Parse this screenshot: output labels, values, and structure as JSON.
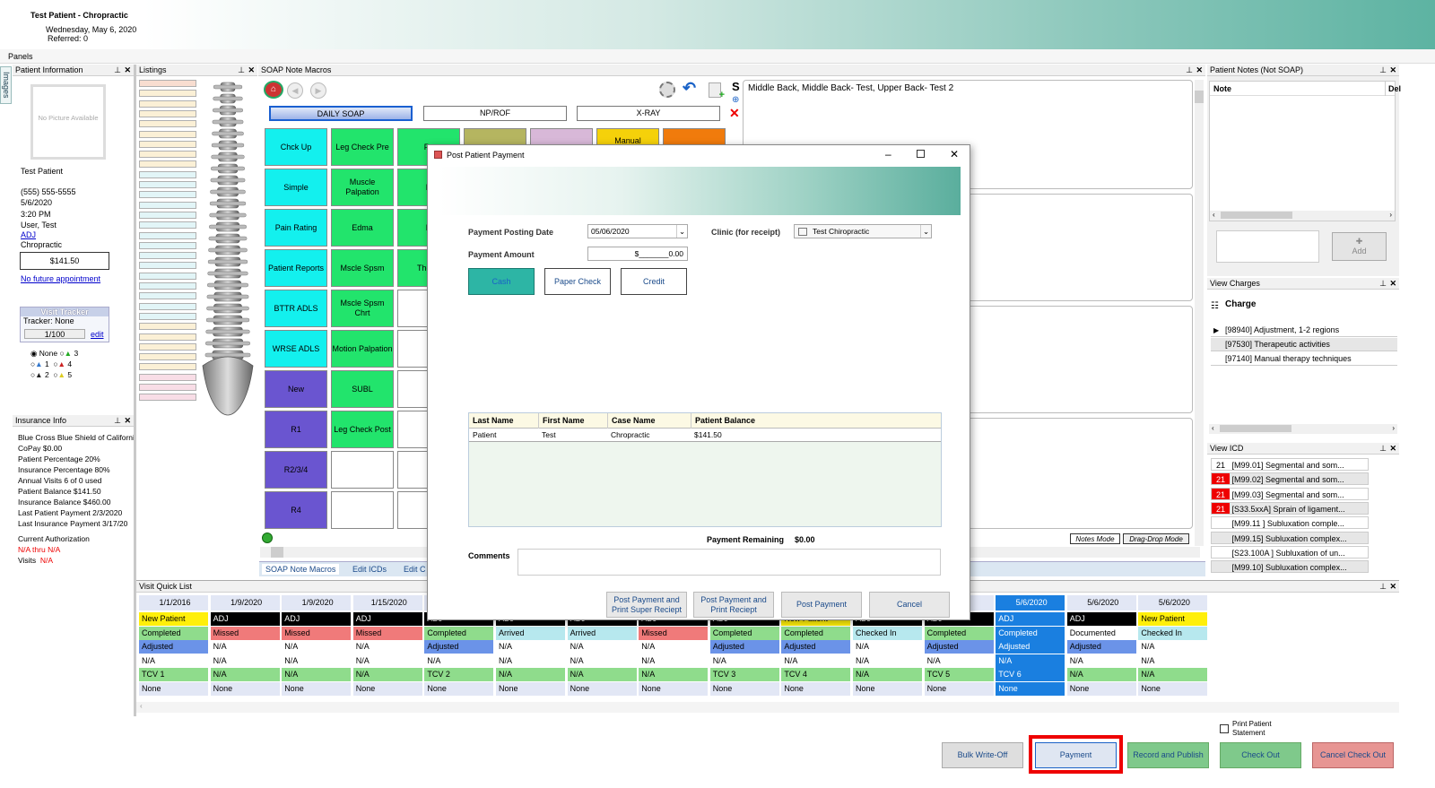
{
  "header": {
    "title": "Test Patient - Chropractic",
    "date": "Wednesday, May 6, 2020",
    "referred": "Referred: 0"
  },
  "panels_label": "Panels",
  "images_tab": "Images",
  "patient_info": {
    "title": "Patient Information",
    "no_picture": "No Picture Available",
    "name": "Test Patient",
    "phone": "(555) 555-5555",
    "date": "5/6/2020",
    "time": "3:20 PM",
    "user": "User, Test",
    "adj": "ADJ",
    "clinic": "Chropractic",
    "balance": "$141.50",
    "future": "No future appointment",
    "tracker_title": "Visit Tracker",
    "tracker": "Tracker: None",
    "tracker_val": "1/100",
    "edit": "edit",
    "radios": [
      "None",
      "1",
      "2",
      "3",
      "4",
      "5"
    ]
  },
  "insurance": {
    "title": "Insurance Info",
    "lines": [
      "Blue Cross Blue Shield of California",
      "CoPay    $0.00",
      "Patient Percentage    20%",
      "Insurance Percentage    80%",
      "Annual Visits    6 of 0 used",
      "Patient Balance    $141.50",
      "Insurance Balance    $460.00",
      "Last Patient Payment        2/3/2020",
      "Last Insurance Payment    3/17/20"
    ],
    "auth": "Current Authorization",
    "na": "N/A thru N/A",
    "visits": "Visits",
    "visits_val": "N/A"
  },
  "listings_title": "Listings",
  "soap": {
    "title": "SOAP Note Macros",
    "tabs": [
      "DAILY SOAP",
      "NP/ROF",
      "X-RAY"
    ],
    "col1": [
      "Chck Up",
      "Simple",
      "Pain Rating",
      "Patient Reports",
      "BTTR ADLS",
      "WRSE ADLS",
      "New",
      "R1",
      "R2/3/4",
      "R4"
    ],
    "col2": [
      "Leg Check Pre",
      "Muscle Palpation",
      "Edma",
      "Mscle Spsm",
      "Mscle Spsm Chrt",
      "Motion Palpation",
      "SUBL",
      "Leg Check Post",
      "",
      ""
    ],
    "col3_partial": [
      "Ps",
      "N",
      "H",
      "Therm"
    ],
    "top_partial": [
      "Manual"
    ],
    "note_text": "Middle Back, Middle Back- Test, Upper Back- Test 2",
    "s_label": "S",
    "notes_mode": "Notes Mode",
    "drag_mode": "Drag-Drop Mode",
    "bottom_tabs": [
      "SOAP Note Macros",
      "Edit ICDs",
      "Edit C"
    ]
  },
  "patient_notes": {
    "title": "Patient Notes (Not SOAP)",
    "col_note": "Note",
    "col_del": "Del",
    "add": "Add"
  },
  "view_charges": {
    "title": "View Charges",
    "header": "Charge",
    "items": [
      "[98940] Adjustment, 1-2 regions",
      "[97530] Therapeutic activities",
      "[97140] Manual therapy techniques"
    ]
  },
  "view_icd": {
    "title": "View ICD",
    "items": [
      {
        "n": "21",
        "t": "[M99.01] Segmental and som..."
      },
      {
        "n": "21",
        "t": "[M99.02] Segmental and som..."
      },
      {
        "n": "21",
        "t": "[M99.03] Segmental and som..."
      },
      {
        "n": "21",
        "t": "[S33.5xxA] Sprain of ligament..."
      },
      {
        "n": "",
        "t": "[M99.11 ] Subluxation comple..."
      },
      {
        "n": "",
        "t": "[M99.15] Subluxation complex..."
      },
      {
        "n": "",
        "t": "[S23.100A ] Subluxation of un..."
      },
      {
        "n": "",
        "t": "[M99.10] Subluxation complex..."
      }
    ]
  },
  "quick_list": {
    "title": "Visit Quick List",
    "columns": [
      {
        "date": "1/1/2016",
        "type": "New Patient",
        "status": "Completed",
        "adj": "Adjusted",
        "na": "N/A",
        "tcv": "TCV 1",
        "none": "None"
      },
      {
        "date": "1/9/2020",
        "type": "ADJ",
        "status": "Missed",
        "adj": "N/A",
        "na": "N/A",
        "tcv": "N/A",
        "none": "None"
      },
      {
        "date": "1/9/2020",
        "type": "ADJ",
        "status": "Missed",
        "adj": "N/A",
        "na": "N/A",
        "tcv": "N/A",
        "none": "None"
      },
      {
        "date": "1/15/2020",
        "type": "ADJ",
        "status": "Missed",
        "adj": "N/A",
        "na": "N/A",
        "tcv": "N/A",
        "none": "None"
      },
      {
        "date": "",
        "type": "ADJ",
        "status": "Completed",
        "adj": "Adjusted",
        "na": "N/A",
        "tcv": "TCV 2",
        "none": "None"
      },
      {
        "date": "",
        "type": "ADJ",
        "status": "Arrived",
        "adj": "N/A",
        "na": "N/A",
        "tcv": "N/A",
        "none": "None"
      },
      {
        "date": "",
        "type": "ADJ",
        "status": "Arrived",
        "adj": "N/A",
        "na": "N/A",
        "tcv": "N/A",
        "none": "None"
      },
      {
        "date": "",
        "type": "ADJ",
        "status": "Missed",
        "adj": "N/A",
        "na": "N/A",
        "tcv": "N/A",
        "none": "None"
      },
      {
        "date": "",
        "type": "ADJ",
        "status": "Completed",
        "adj": "Adjusted",
        "na": "N/A",
        "tcv": "TCV 3",
        "none": "None"
      },
      {
        "date": "",
        "type": "New Patient",
        "status": "Completed",
        "adj": "Adjusted",
        "na": "N/A",
        "tcv": "TCV 4",
        "none": "None"
      },
      {
        "date": "",
        "type": "ADJ",
        "status": "Checked In",
        "adj": "N/A",
        "na": "N/A",
        "tcv": "N/A",
        "none": "None"
      },
      {
        "date": "20",
        "type": "ADJ",
        "status": "Completed",
        "adj": "Adjusted",
        "na": "N/A",
        "tcv": "TCV 5",
        "none": "None"
      },
      {
        "date": "5/6/2020",
        "type": "ADJ",
        "status": "Completed",
        "adj": "Adjusted",
        "na": "N/A",
        "tcv": "TCV 6",
        "none": "None"
      },
      {
        "date": "5/6/2020",
        "type": "ADJ",
        "status": "Documented",
        "adj": "Adjusted",
        "na": "N/A",
        "tcv": "N/A",
        "none": "None"
      },
      {
        "date": "5/6/2020",
        "type": "New Patient",
        "status": "Checked In",
        "adj": "N/A",
        "na": "N/A",
        "tcv": "N/A",
        "none": "None"
      }
    ]
  },
  "dialog": {
    "title": "Post Patient Payment",
    "date_label": "Payment Posting Date",
    "date_val": "05/06/2020",
    "clinic_label": "Clinic (for receipt)",
    "clinic_val": "Test Chiropractic",
    "amount_label": "Payment Amount",
    "amount_val": "$_______0.00",
    "methods": [
      "Cash",
      "Paper Check",
      "Credit"
    ],
    "table_headers": [
      "Last Name",
      "First Name",
      "Case Name",
      "Patient Balance"
    ],
    "table_row": [
      "Patient",
      "Test",
      "Chropractic",
      "$141.50"
    ],
    "remaining_label": "Payment Remaining",
    "remaining_val": "$0.00",
    "comments": "Comments",
    "btn_super": "Post Payment and Print Super Reciept",
    "btn_print": "Post Payment and Print Reciept",
    "btn_post": "Post Payment",
    "btn_cancel": "Cancel"
  },
  "footer": {
    "print_stmt": "Print Patient Statement",
    "bulk": "Bulk Write-Off",
    "payment": "Payment",
    "record": "Record and Publish",
    "checkout": "Check Out",
    "cancel_checkout": "Cancel Check Out"
  }
}
